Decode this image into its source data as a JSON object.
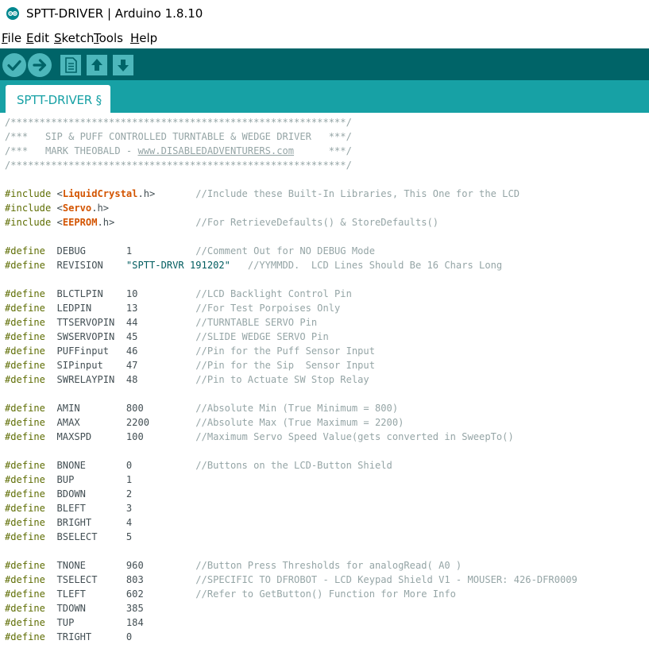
{
  "window": {
    "title": "SPTT-DRIVER | Arduino 1.8.10"
  },
  "menu": [
    {
      "mnemonic": "F",
      "rest": "ile"
    },
    {
      "mnemonic": "E",
      "rest": "dit"
    },
    {
      "mnemonic": "S",
      "rest": "ketch"
    },
    {
      "mnemonic": "T",
      "rest": "ools"
    },
    {
      "mnemonic": "H",
      "rest": "elp"
    }
  ],
  "toolbar": {
    "buttons": [
      {
        "name": "verify-button",
        "icon": "checkmark-icon"
      },
      {
        "name": "upload-button",
        "icon": "arrow-right-icon"
      },
      {
        "name": "new-button",
        "icon": "new-file-icon"
      },
      {
        "name": "open-button",
        "icon": "arrow-up-icon"
      },
      {
        "name": "save-button",
        "icon": "arrow-down-icon"
      }
    ]
  },
  "colors": {
    "toolbar_bg": "#006468",
    "tabbar_bg": "#17A1A5",
    "comment": "#95A5A6",
    "preprocessor": "#5E6D03",
    "library": "#D35400",
    "string": "#005C5F",
    "text": "#434F54"
  },
  "tabs": [
    {
      "label": "SPTT-DRIVER §",
      "active": true
    }
  ],
  "editor": {
    "lines": [
      [
        [
          "comment",
          "/**********************************************************/"
        ]
      ],
      [
        [
          "comment",
          "/***   SIP & PUFF CONTROLLED TURNTABLE & WEDGE DRIVER   ***/"
        ]
      ],
      [
        [
          "comment",
          "/***   MARK THEOBALD - "
        ],
        [
          "link",
          "www.DISABLEDADVENTURERS.com"
        ],
        [
          "comment",
          "      ***/"
        ]
      ],
      [
        [
          "comment",
          "/**********************************************************/"
        ]
      ],
      [],
      [
        [
          "pre",
          "#include"
        ],
        [
          "plain",
          " <"
        ],
        [
          "lib",
          "LiquidCrystal"
        ],
        [
          "plain",
          ".h>       "
        ],
        [
          "comment",
          "//Include these Built-In Libraries, This One for the LCD"
        ]
      ],
      [
        [
          "pre",
          "#include"
        ],
        [
          "plain",
          " <"
        ],
        [
          "lib",
          "Servo"
        ],
        [
          "plain",
          ".h>"
        ]
      ],
      [
        [
          "pre",
          "#include"
        ],
        [
          "plain",
          " <"
        ],
        [
          "lib",
          "EEPROM"
        ],
        [
          "plain",
          ".h>              "
        ],
        [
          "comment",
          "//For RetrieveDefaults() & StoreDefaults()"
        ]
      ],
      [],
      [
        [
          "pre",
          "#define"
        ],
        [
          "plain",
          "  DEBUG       1           "
        ],
        [
          "comment",
          "//Comment Out for NO DEBUG Mode"
        ]
      ],
      [
        [
          "pre",
          "#define"
        ],
        [
          "plain",
          "  REVISION    "
        ],
        [
          "str",
          "\"SPTT-DRVR 191202\""
        ],
        [
          "plain",
          "   "
        ],
        [
          "comment",
          "//YYMMDD.  LCD Lines Should Be 16 Chars Long"
        ]
      ],
      [],
      [
        [
          "pre",
          "#define"
        ],
        [
          "plain",
          "  BLCTLPIN    10          "
        ],
        [
          "comment",
          "//LCD Backlight Control Pin"
        ]
      ],
      [
        [
          "pre",
          "#define"
        ],
        [
          "plain",
          "  LEDPIN      13          "
        ],
        [
          "comment",
          "//For Test Porpoises Only"
        ]
      ],
      [
        [
          "pre",
          "#define"
        ],
        [
          "plain",
          "  TTSERVOPIN  44          "
        ],
        [
          "comment",
          "//TURNTABLE SERVO Pin"
        ]
      ],
      [
        [
          "pre",
          "#define"
        ],
        [
          "plain",
          "  SWSERVOPIN  45          "
        ],
        [
          "comment",
          "//SLIDE WEDGE SERVO Pin"
        ]
      ],
      [
        [
          "pre",
          "#define"
        ],
        [
          "plain",
          "  PUFFinput   46          "
        ],
        [
          "comment",
          "//Pin for the Puff Sensor Input"
        ]
      ],
      [
        [
          "pre",
          "#define"
        ],
        [
          "plain",
          "  SIPinput    47          "
        ],
        [
          "comment",
          "//Pin for the Sip  Sensor Input"
        ]
      ],
      [
        [
          "pre",
          "#define"
        ],
        [
          "plain",
          "  SWRELAYPIN  48          "
        ],
        [
          "comment",
          "//Pin to Actuate SW Stop Relay"
        ]
      ],
      [],
      [
        [
          "pre",
          "#define"
        ],
        [
          "plain",
          "  AMIN        800         "
        ],
        [
          "comment",
          "//Absolute Min (True Minimum = 800)"
        ]
      ],
      [
        [
          "pre",
          "#define"
        ],
        [
          "plain",
          "  AMAX        2200        "
        ],
        [
          "comment",
          "//Absolute Max (True Maximum = 2200)"
        ]
      ],
      [
        [
          "pre",
          "#define"
        ],
        [
          "plain",
          "  MAXSPD      100         "
        ],
        [
          "comment",
          "//Maximum Servo Speed Value(gets converted in SweepTo()"
        ]
      ],
      [],
      [
        [
          "pre",
          "#define"
        ],
        [
          "plain",
          "  BNONE       0           "
        ],
        [
          "comment",
          "//Buttons on the LCD-Button Shield"
        ]
      ],
      [
        [
          "pre",
          "#define"
        ],
        [
          "plain",
          "  BUP         1"
        ]
      ],
      [
        [
          "pre",
          "#define"
        ],
        [
          "plain",
          "  BDOWN       2"
        ]
      ],
      [
        [
          "pre",
          "#define"
        ],
        [
          "plain",
          "  BLEFT       3"
        ]
      ],
      [
        [
          "pre",
          "#define"
        ],
        [
          "plain",
          "  BRIGHT      4"
        ]
      ],
      [
        [
          "pre",
          "#define"
        ],
        [
          "plain",
          "  BSELECT     5"
        ]
      ],
      [],
      [
        [
          "pre",
          "#define"
        ],
        [
          "plain",
          "  TNONE       960         "
        ],
        [
          "comment",
          "//Button Press Thresholds for analogRead( A0 )"
        ]
      ],
      [
        [
          "pre",
          "#define"
        ],
        [
          "plain",
          "  TSELECT     803         "
        ],
        [
          "comment",
          "//SPECIFIC TO DFROBOT - LCD Keypad Shield V1 - MOUSER: 426-DFR0009"
        ]
      ],
      [
        [
          "pre",
          "#define"
        ],
        [
          "plain",
          "  TLEFT       602         "
        ],
        [
          "comment",
          "//Refer to GetButton() Function for More Info"
        ]
      ],
      [
        [
          "pre",
          "#define"
        ],
        [
          "plain",
          "  TDOWN       385"
        ]
      ],
      [
        [
          "pre",
          "#define"
        ],
        [
          "plain",
          "  TUP         184"
        ]
      ],
      [
        [
          "pre",
          "#define"
        ],
        [
          "plain",
          "  TRIGHT      0"
        ]
      ]
    ]
  }
}
